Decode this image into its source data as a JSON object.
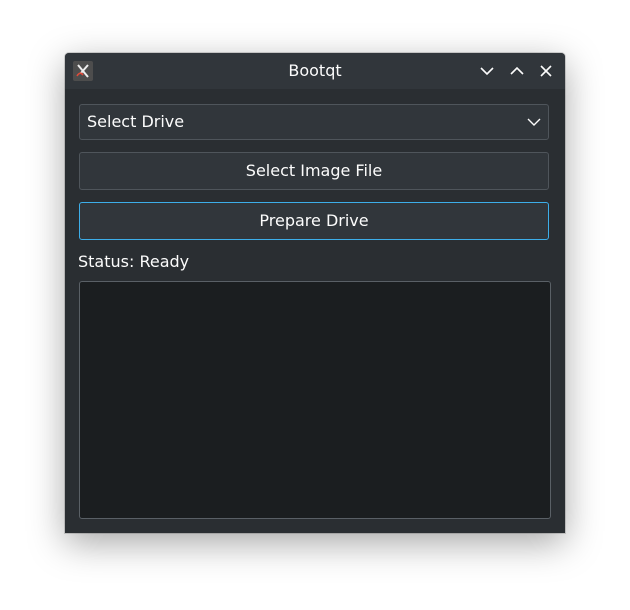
{
  "window": {
    "title": "Bootqt",
    "app_icon": "bootqt-app-icon",
    "controls": [
      "minimize-icon",
      "maximize-icon",
      "close-icon"
    ]
  },
  "drive_select": {
    "value": "Select Drive",
    "icon": "chevron-down-icon"
  },
  "buttons": {
    "select_image": "Select Image File",
    "prepare_drive": "Prepare Drive"
  },
  "status": {
    "text": "Status: Ready"
  },
  "log": {
    "text": ""
  },
  "colors": {
    "window_bg": "#2a2e32",
    "titlebar_bg": "#31363b",
    "focus_accent": "#3daee9",
    "text": "#fcfcfc",
    "log_bg": "#1b1e20"
  }
}
